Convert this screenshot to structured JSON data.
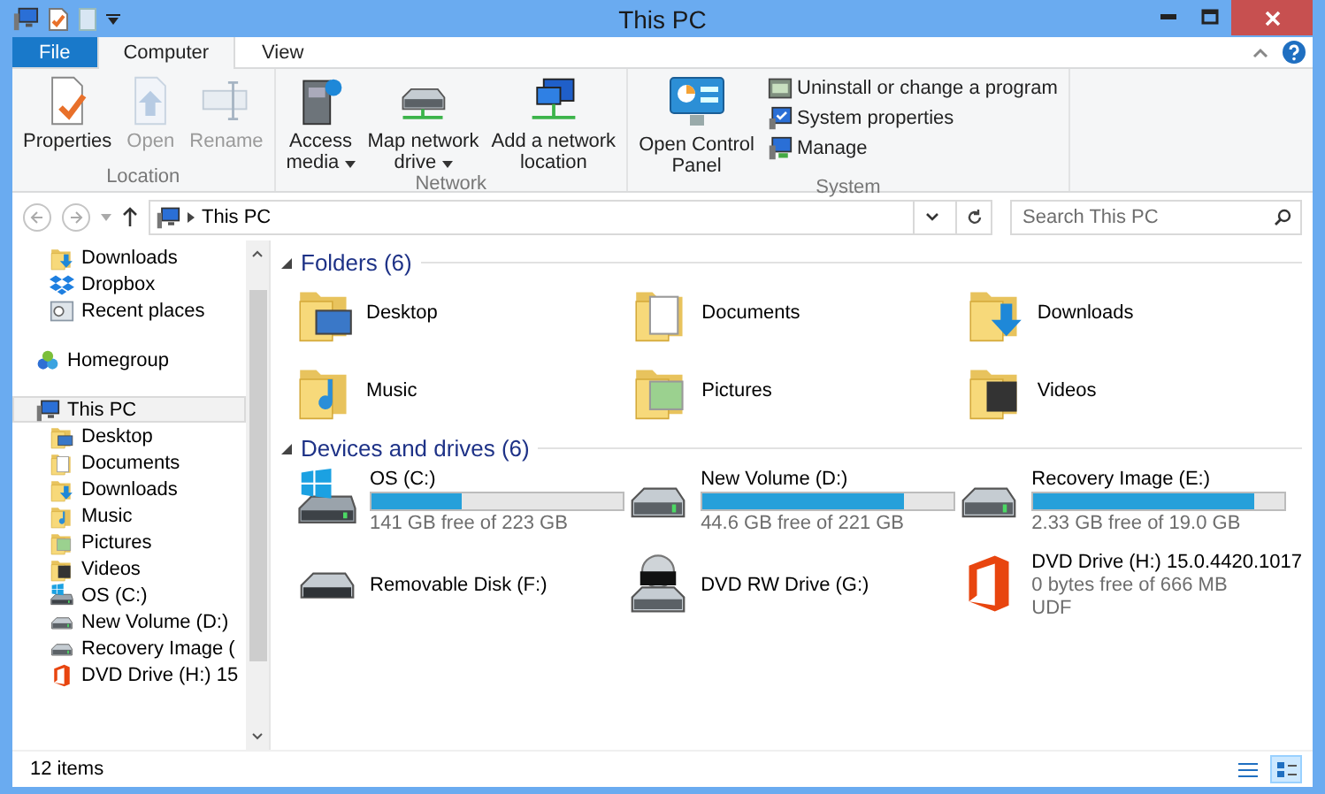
{
  "window": {
    "title": "This PC"
  },
  "ribbon_tabs": [
    {
      "label": "File",
      "kind": "file",
      "selected": false
    },
    {
      "label": "Computer",
      "kind": "tab",
      "selected": true
    },
    {
      "label": "View",
      "kind": "tab",
      "selected": false
    }
  ],
  "ribbon_groups": [
    {
      "label": "Location",
      "buttons": [
        {
          "label": "Properties",
          "kind": "properties",
          "disabled": false,
          "dropdown": false
        },
        {
          "label": "Open",
          "kind": "open",
          "disabled": true,
          "dropdown": false
        },
        {
          "label": "Rename",
          "kind": "rename",
          "disabled": true,
          "dropdown": false
        }
      ]
    },
    {
      "label": "Network",
      "buttons": [
        {
          "label": "Access\nmedia",
          "kind": "media",
          "disabled": false,
          "dropdown": true
        },
        {
          "label": "Map network\ndrive",
          "kind": "map-drive",
          "disabled": false,
          "dropdown": true
        },
        {
          "label": "Add a network\nlocation",
          "kind": "network-location",
          "disabled": false,
          "dropdown": false
        }
      ]
    },
    {
      "label": "System",
      "buttons": [
        {
          "label": "Open Control\nPanel",
          "kind": "control-panel",
          "disabled": false,
          "dropdown": false
        }
      ],
      "small_buttons": [
        {
          "label": "Uninstall or change a program",
          "kind": "programs"
        },
        {
          "label": "System properties",
          "kind": "system-properties"
        },
        {
          "label": "Manage",
          "kind": "manage"
        }
      ]
    }
  ],
  "address_bar": {
    "location": "This PC"
  },
  "search": {
    "placeholder": "Search This PC"
  },
  "navigation": {
    "items": [
      {
        "children": [
          {
            "label": "Downloads",
            "kind": "folder-downloads",
            "selected": false
          },
          {
            "label": "Dropbox",
            "kind": "dropbox",
            "selected": false
          },
          {
            "label": "Recent places",
            "kind": "recent",
            "selected": false
          }
        ]
      },
      {
        "label": "Homegroup",
        "kind": "homegroup",
        "selected": false
      },
      {
        "label": "This PC",
        "kind": "pc",
        "selected": true,
        "children": [
          {
            "label": "Desktop",
            "kind": "folder-desktop",
            "selected": false
          },
          {
            "label": "Documents",
            "kind": "folder-documents",
            "selected": false
          },
          {
            "label": "Downloads",
            "kind": "folder-downloads",
            "selected": false
          },
          {
            "label": "Music",
            "kind": "folder-music",
            "selected": false
          },
          {
            "label": "Pictures",
            "kind": "folder-pictures",
            "selected": false
          },
          {
            "label": "Videos",
            "kind": "folder-videos",
            "selected": false
          },
          {
            "label": "OS (C:)",
            "kind": "drive-windows",
            "selected": false
          },
          {
            "label": "New Volume (D:)",
            "kind": "drive",
            "selected": false
          },
          {
            "label": "Recovery Image (",
            "kind": "drive",
            "selected": false
          },
          {
            "label": "DVD Drive (H:) 15",
            "kind": "office",
            "selected": false
          }
        ]
      }
    ]
  },
  "folders": {
    "title": "Folders (6)",
    "expanded": true,
    "items": [
      {
        "label": "Desktop",
        "kind": "folder-desktop"
      },
      {
        "label": "Documents",
        "kind": "folder-documents"
      },
      {
        "label": "Downloads",
        "kind": "folder-downloads"
      },
      {
        "label": "Music",
        "kind": "folder-music"
      },
      {
        "label": "Pictures",
        "kind": "folder-pictures"
      },
      {
        "label": "Videos",
        "kind": "folder-videos"
      }
    ]
  },
  "drives": {
    "title": "Devices and drives (6)",
    "expanded": true,
    "items": [
      {
        "name": "OS (C:)",
        "kind": "drive-windows",
        "level": 0.36,
        "free": "141 GB free of 223 GB"
      },
      {
        "name": "New Volume (D:)",
        "kind": "drive",
        "level": 0.8,
        "free": "44.6 GB free of 221 GB"
      },
      {
        "name": "Recovery Image (E:)",
        "kind": "drive",
        "level": 0.88,
        "free": "2.33 GB free of 19.0 GB"
      },
      {
        "name": "Removable Disk (F:)",
        "kind": "removable"
      },
      {
        "name": "DVD RW Drive (G:)",
        "kind": "dvd"
      },
      {
        "name": "DVD Drive (H:) 15.0.4420.1017",
        "kind": "office",
        "free": "0 bytes free of 666 MB",
        "file_system": "UDF"
      }
    ]
  },
  "status_bar": {
    "items": "12 items",
    "view_buttons": [
      {
        "kind": "details",
        "selected": false
      },
      {
        "kind": "tiles",
        "selected": true
      }
    ]
  }
}
